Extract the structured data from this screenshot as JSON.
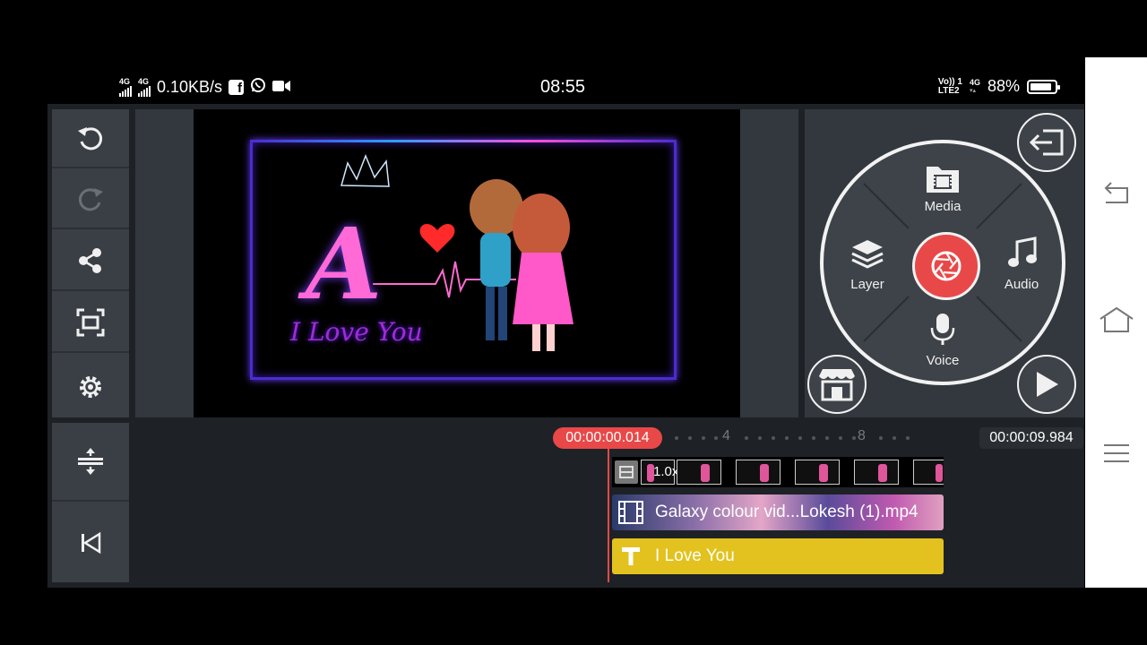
{
  "status_bar": {
    "network_left": "4G",
    "network_left2": "4G",
    "speed": "0.10KB/s",
    "time": "08:55",
    "volte": "Vo)) 1",
    "lte": "LTE2",
    "network_right": "4G",
    "battery": "88%",
    "battery_level": 0.88
  },
  "toolbar": {
    "undo": "undo-icon",
    "redo": "redo-icon",
    "share": "share-icon",
    "fullscreen": "fullscreen-icon",
    "settings": "gear-icon",
    "adjust": "timeline-adjust-icon",
    "to_start": "skip-to-start-icon"
  },
  "preview": {
    "letter": "A",
    "caption": "I Love You"
  },
  "media_wheel": {
    "media": "Media",
    "layer": "Layer",
    "audio": "Audio",
    "voice": "Voice"
  },
  "timeline": {
    "current_time": "00:00:00.014",
    "end_time": "00:00:09.984",
    "tick_4": "4",
    "tick_8": "8",
    "speed_label": "1.0x",
    "video_clip": "Galaxy colour vid...Lokesh (1).mp4",
    "text_clip": "I Love You"
  },
  "colors": {
    "accent": "#e94848",
    "text_clip": "#e3c21f",
    "panel": "#3a3f45",
    "background": "#1e2226"
  }
}
